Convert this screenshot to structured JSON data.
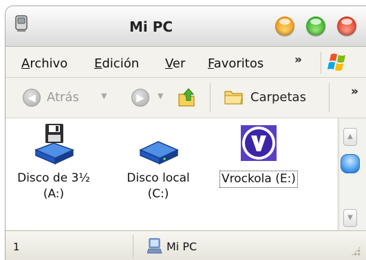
{
  "window": {
    "title": "Mi PC",
    "title_icon": "computer-icon",
    "controls": [
      "minimize-button",
      "maximize-button",
      "close-button"
    ]
  },
  "menubar": {
    "items": [
      {
        "label_ul": "A",
        "label_rest": "rchivo"
      },
      {
        "label_ul": "E",
        "label_rest": "dición"
      },
      {
        "label_ul": "V",
        "label_rest": "er"
      },
      {
        "label_ul": "F",
        "label_rest": "avoritos"
      }
    ],
    "overflow": "»",
    "logo_icon": "windows-flag-icon"
  },
  "toolbar": {
    "back_label": "Atrás",
    "folders_label": "Carpetas",
    "overflow": "»"
  },
  "drives": [
    {
      "line1": "Disco de 3½",
      "line2": "(A:)",
      "icon": "floppy-drive-icon"
    },
    {
      "line1": "Disco local",
      "line2": "(C:)",
      "icon": "hard-drive-icon"
    },
    {
      "line1": "Vrockola (E:)",
      "line2": "",
      "icon": "vrockola-icon"
    }
  ],
  "statusbar": {
    "count": "1",
    "location": "Mi PC",
    "location_icon": "computer-icon"
  },
  "colors": {
    "minimize": "#f19b1c",
    "maximize": "#36b52a",
    "close": "#e5432b",
    "vrockola": "#4a2fb0"
  }
}
